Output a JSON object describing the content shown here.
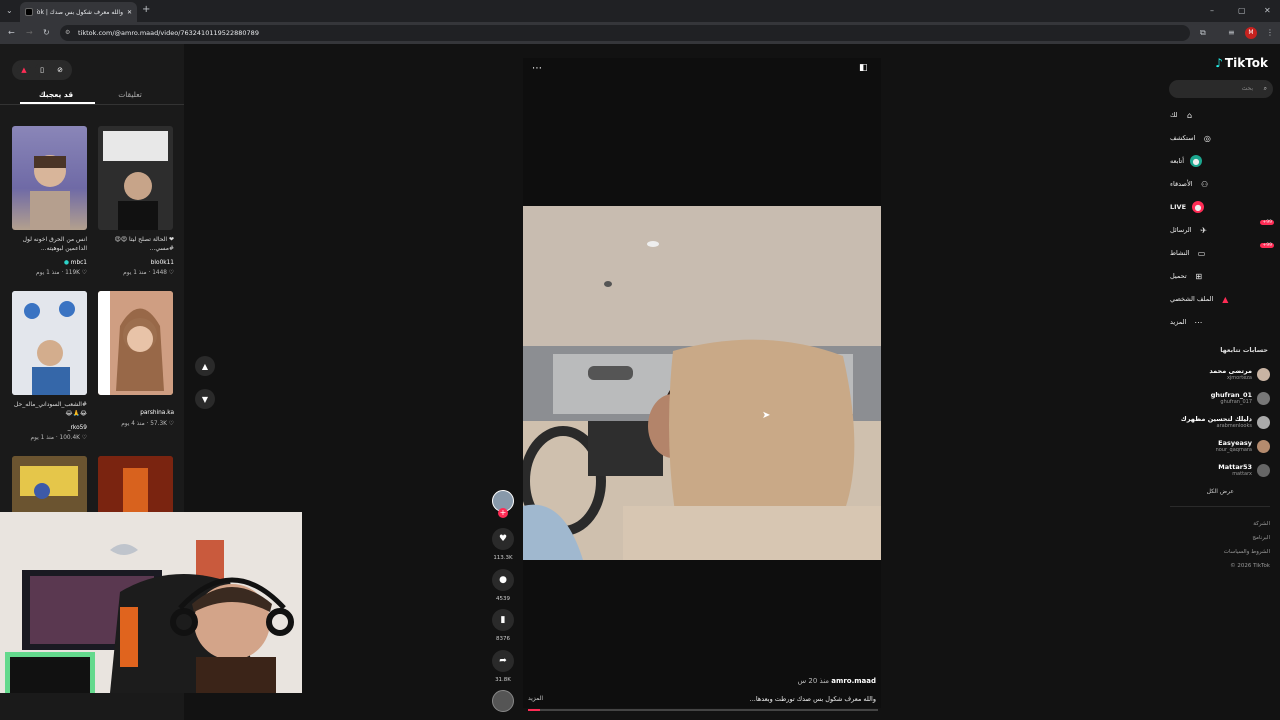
{
  "browser": {
    "tab_title": "والله معرف شكول بس صدك | TikTok",
    "url": "tiktok.com/@amro.maad/video/7632410119522880789",
    "profile_initial": "M"
  },
  "left_panel": {
    "tabs": [
      "قد يعجبك",
      "تعليقات"
    ],
    "videos": [
      {
        "desc": "انس من الحرق اخونه لول الداعمين لبوهيته...",
        "author": "mbc1",
        "likes": "119K",
        "age": "منذ 1 يوم"
      },
      {
        "desc": "❤ الحالة تصلح ليتا 😍😍 #مسي...",
        "author": "blo0k11",
        "likes": "1448",
        "age": "منذ 1 يوم"
      },
      {
        "desc": "#الشعب_السوداني_ماله_حل 😂🙏😂",
        "author": "rko59_",
        "likes": "100.4K",
        "age": "منذ 1 يوم"
      },
      {
        "desc": "",
        "author": "parshina.ka",
        "likes": "57.3K",
        "age": "منذ 4 يوم"
      }
    ]
  },
  "video": {
    "author": "amro.maad",
    "age": "منذ 20 س",
    "caption": "والله معرف شكول بس صدك تورطت وبعدها...",
    "more_label": "المزيد",
    "actions": {
      "likes": "113.3K",
      "comments": "4539",
      "saves": "8376",
      "shares": "31.8K"
    }
  },
  "sidebar": {
    "logo": "TikTok",
    "search_placeholder": "بحث",
    "nav": [
      {
        "label": "لك",
        "icon": "home-icon"
      },
      {
        "label": "استكشف",
        "icon": "compass-icon"
      },
      {
        "label": "أتابعه",
        "icon": "following-icon"
      },
      {
        "label": "الأصدقاء",
        "icon": "friends-icon"
      },
      {
        "label": "LIVE",
        "icon": "live-icon"
      },
      {
        "label": "الرسائل",
        "icon": "message-icon",
        "badge": "99+"
      },
      {
        "label": "النشاط",
        "icon": "activity-icon",
        "badge": "99+"
      },
      {
        "label": "تحميل",
        "icon": "upload-icon"
      },
      {
        "label": "الملف الشخصي",
        "icon": "profile-icon"
      },
      {
        "label": "المزيد",
        "icon": "more-icon"
      }
    ],
    "following_title": "حسابات تتابعها",
    "following": [
      {
        "name": "مرتضى محمد",
        "handle": "xjmorteza"
      },
      {
        "name": "ghufran_01",
        "handle": "ghufran_017"
      },
      {
        "name": "دليلك لتحسين مظهرك",
        "handle": "arabmenlooks"
      },
      {
        "name": "Easyeasy",
        "handle": "nour_qaqmara"
      },
      {
        "name": "Mattar53",
        "handle": "mattarx"
      }
    ],
    "see_all": "عرض الكل",
    "footer": [
      "الشركة",
      "البرنامج",
      "الشروط والسياسات",
      "© 2026 TikTok"
    ]
  },
  "colors": {
    "brand_red": "#fe2c55",
    "bg": "#121212"
  }
}
